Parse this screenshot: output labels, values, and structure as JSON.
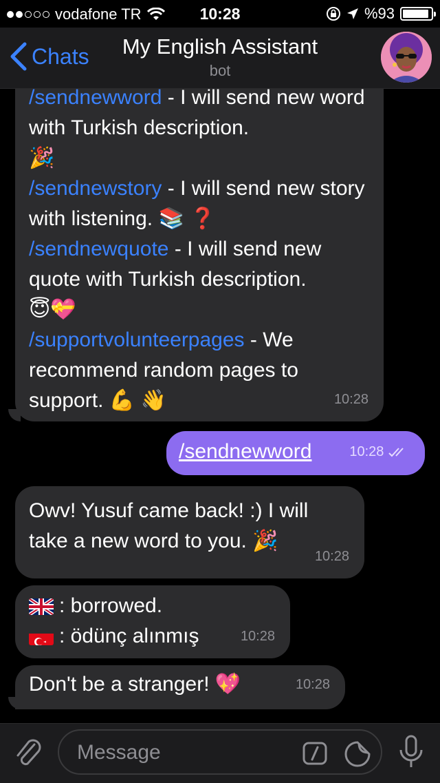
{
  "status_bar": {
    "carrier": "vodafone TR",
    "time": "10:28",
    "battery": "%93",
    "battery_level": 0.93
  },
  "nav": {
    "back_label": "Chats",
    "title": "My English Assistant",
    "subtitle": "bot"
  },
  "messages": {
    "first": {
      "cmd1": "/sendnewword",
      "text1": " - I will send new word with Turkish description.",
      "cmd2": "/sendnewstory",
      "text2": " - I will send new story with listening.",
      "cmd3": "/sendnewquote",
      "text3": " - I will send new quote with Turkish description.",
      "cmd4": "/supportvolunteerpages",
      "text4": " - We recommend random pages to support.",
      "time": "10:28"
    },
    "outgoing": {
      "text": "/sendnewword",
      "time": "10:28"
    },
    "reply1": {
      "text": "Owv! Yusuf came back! :) I will take a new word to you.",
      "time": "10:28"
    },
    "reply2": {
      "line1": ": borrowed.",
      "line2": ": ödünç alınmış",
      "time": "10:28"
    },
    "reply3": {
      "text": "Don't be a stranger!",
      "time": "10:28"
    }
  },
  "input": {
    "placeholder": "Message"
  },
  "colors": {
    "accent": "#3b82ff",
    "outgoing_bubble": "#8c6cf0",
    "incoming_bubble": "#2c2c2e"
  }
}
